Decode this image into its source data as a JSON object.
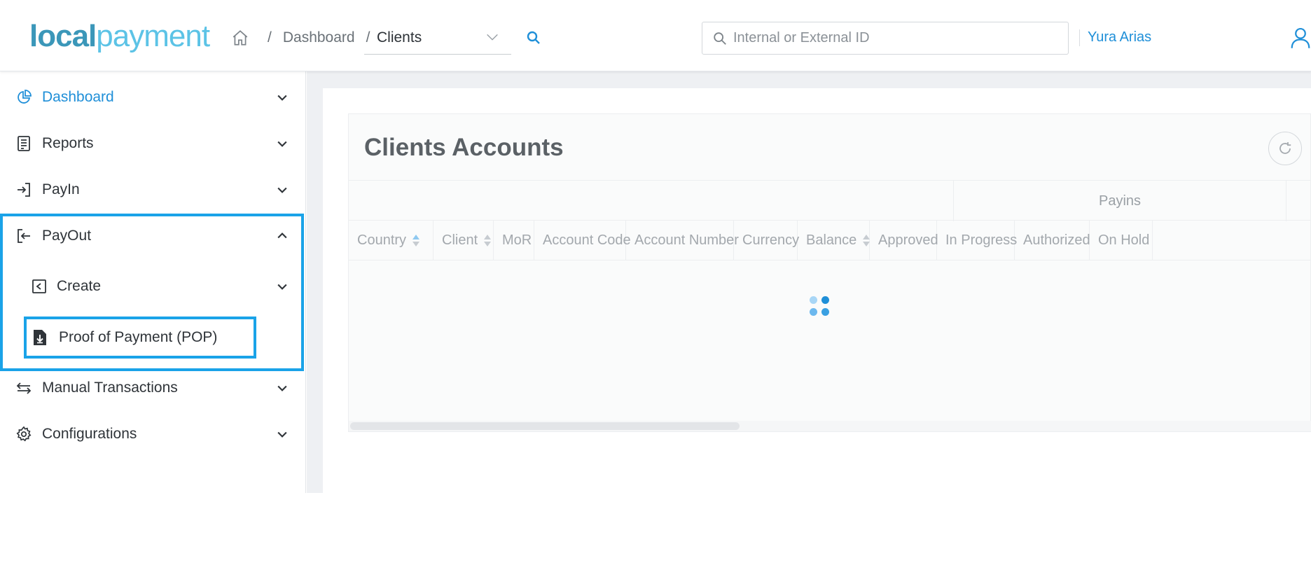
{
  "header": {
    "logo_part1": "local",
    "logo_part2": "payment",
    "breadcrumb": {
      "home_icon": "home-icon",
      "separator": "/",
      "dashboard": "Dashboard"
    },
    "client_select": {
      "value": "Clients",
      "icon": "chevron-down-icon"
    },
    "search_icon": "search-icon",
    "id_search": {
      "placeholder": "Internal or External ID",
      "value": ""
    },
    "user": {
      "name": "Yura Arias",
      "icon": "user-icon"
    }
  },
  "sidebar": {
    "items": [
      {
        "label": "Dashboard",
        "icon": "pie-chart-icon",
        "state": "collapsed",
        "active": true
      },
      {
        "label": "Reports",
        "icon": "document-list-icon",
        "state": "collapsed"
      },
      {
        "label": "PayIn",
        "icon": "sign-in-icon",
        "state": "collapsed"
      },
      {
        "label": "PayOut",
        "icon": "sign-out-icon",
        "state": "expanded"
      },
      {
        "label": "Create",
        "icon": "caret-left-square-icon",
        "state": "collapsed",
        "child_of": "PayOut"
      },
      {
        "label": "Proof of Payment (POP)",
        "icon": "file-download-icon",
        "child_of": "PayOut"
      },
      {
        "label": "Manual Transactions",
        "icon": "exchange-arrows-icon",
        "state": "collapsed"
      },
      {
        "label": "Configurations",
        "icon": "gear-icon",
        "state": "collapsed"
      }
    ],
    "accent_color": "#1f8fd8",
    "highlight_color": "#1aa3e8"
  },
  "main": {
    "title": "Clients Accounts",
    "refresh_icon": "refresh-icon",
    "column_group": "Payins",
    "columns": [
      {
        "label": "Country",
        "sortable": true,
        "sort": "asc"
      },
      {
        "label": "Client",
        "sortable": true
      },
      {
        "label": "MoR",
        "sortable": false
      },
      {
        "label": "Account Code",
        "sortable": false
      },
      {
        "label": "Account Number",
        "sortable": false
      },
      {
        "label": "Currency",
        "sortable": false
      },
      {
        "label": "Balance",
        "sortable": true
      },
      {
        "label": "Approved",
        "sortable": false
      },
      {
        "label": "In Progress",
        "sortable": false
      },
      {
        "label": "Authorized",
        "sortable": false
      },
      {
        "label": "On Hold",
        "sortable": false
      }
    ],
    "loading": true,
    "loading_icon": "loading-spinner-icon"
  }
}
